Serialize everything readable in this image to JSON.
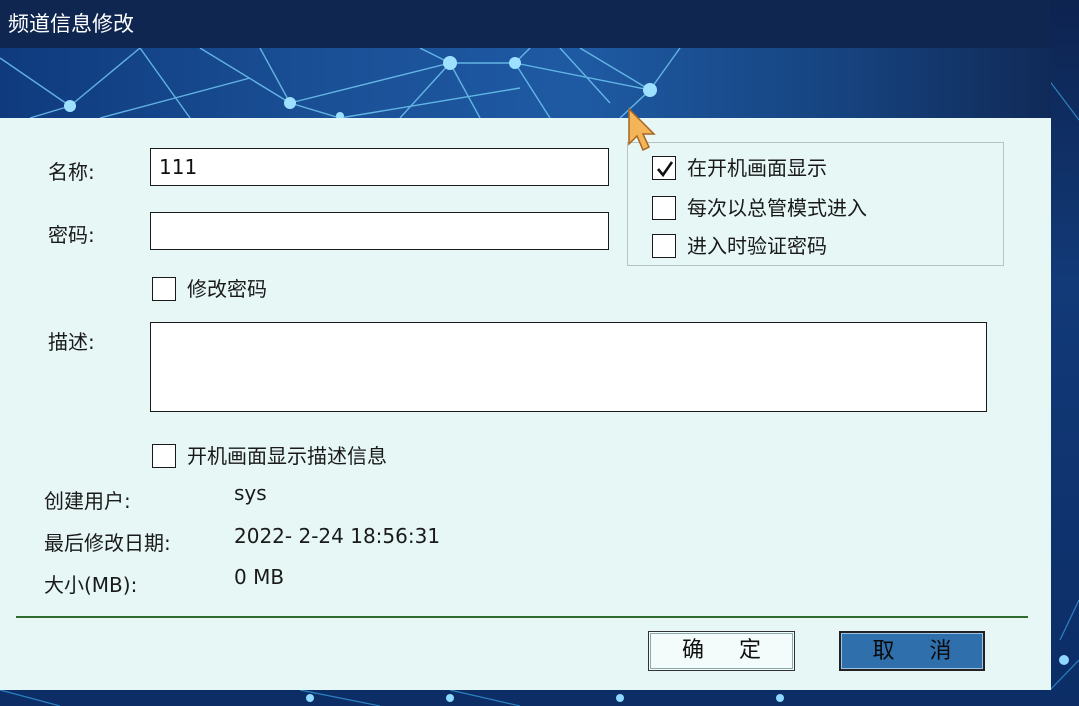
{
  "window": {
    "title": "频道信息修改"
  },
  "form": {
    "name_label": "名称:",
    "name_value": "111",
    "password_label": "密码:",
    "password_value": "",
    "change_password_label": "修改密码",
    "change_password_checked": false,
    "description_label": "描述:",
    "description_value": "",
    "show_description_label": "开机画面显示描述信息",
    "show_description_checked": false
  },
  "options": {
    "show_on_boot": {
      "label": "在开机画面显示",
      "checked": true
    },
    "admin_mode": {
      "label": "每次以总管模式进入",
      "checked": false
    },
    "verify_password": {
      "label": "进入时验证密码",
      "checked": false
    }
  },
  "info": {
    "creator_label": "创建用户:",
    "creator_value": "sys",
    "modified_label": "最后修改日期:",
    "modified_value": "2022- 2-24 18:56:31",
    "size_label": "大小(MB):",
    "size_value": "0 MB"
  },
  "buttons": {
    "ok": "确 定",
    "cancel": "取 消"
  },
  "colors": {
    "title_bg": "#0e2650",
    "dialog_bg": "#e6f7f6",
    "cancel_bg": "#2f6fab",
    "divider": "#2f6a2f"
  },
  "icons": [
    "check-icon",
    "mouse-cursor-icon"
  ]
}
